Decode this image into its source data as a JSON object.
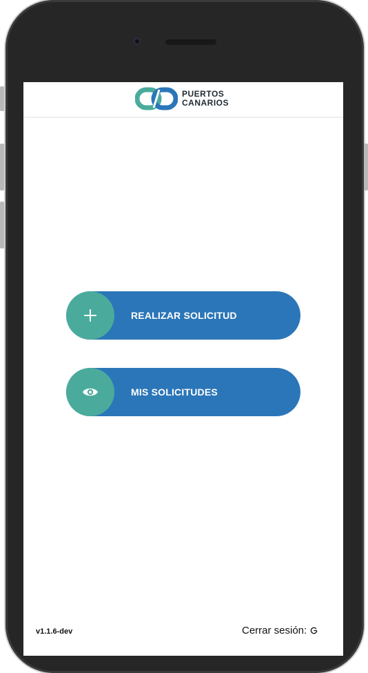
{
  "header": {
    "brand_line1": "PUERTOS",
    "brand_line2": "CANARIOS",
    "logo_icon": "puertos-canarios-logo"
  },
  "actions": [
    {
      "label": "REALIZAR SOLICITUD",
      "icon": "plus-icon"
    },
    {
      "label": "MIS SOLICITUDES",
      "icon": "eye-icon"
    }
  ],
  "footer": {
    "version": "v1.1.6-dev",
    "logout_label": "Cerrar sesión:",
    "logout_icon": "power-icon"
  },
  "colors": {
    "primary": "#2b76b8",
    "accent": "#4aab9c",
    "background": "#ffffff"
  }
}
